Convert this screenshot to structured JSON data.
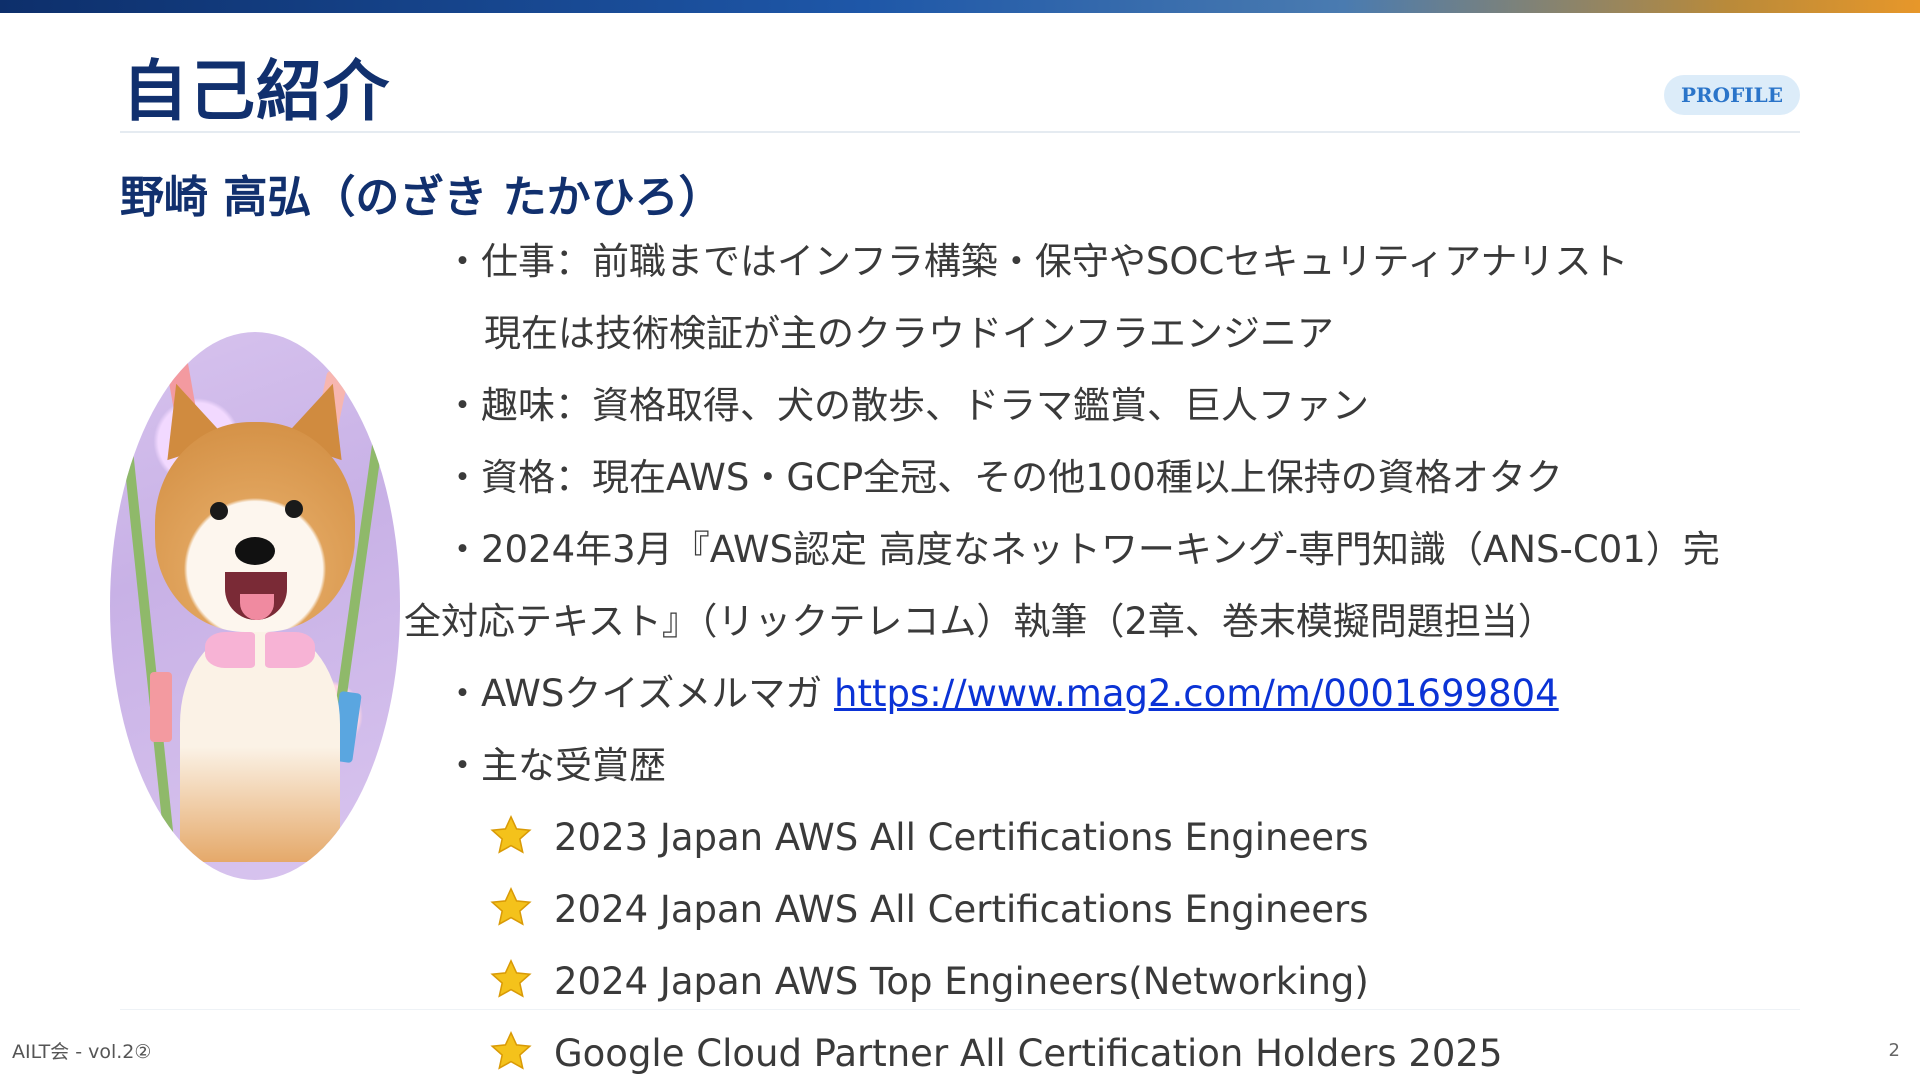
{
  "header": {
    "title": "自己紹介",
    "badge": "PROFILE"
  },
  "profile": {
    "name": "野崎 高弘（のざき たかひろ）",
    "lines": [
      "・仕事：前職まではインフラ構築・保守やSOCセキュリティアナリスト",
      "現在は技術検証が主のクラウドインフラエンジニア",
      "・趣味：資格取得、犬の散歩、ドラマ鑑賞、巨人ファン",
      "・資格：現在AWS・GCP全冠、その他100種以上保持の資格オタク",
      "・2024年3月『AWS認定 高度なネットワーキング-専門知識（ANS-C01）完",
      "全対応テキスト』（リックテレコム）執筆（2章、巻末模擬問題担当）"
    ],
    "newsletter": {
      "prefix": "・AWSクイズメルマガ ",
      "url": "https://www.mag2.com/m/0001699804"
    },
    "awards_heading": "・主な受賞歴",
    "awards": [
      "2023 Japan AWS All Certifications Engineers",
      "2024 Japan AWS All Certifications Engineers",
      "2024 Japan AWS Top Engineers(Networking)",
      "Google Cloud Partner All Certification Holders 2025"
    ],
    "award_icon": "star-icon"
  },
  "footer": {
    "event": "AILT会 - vol.2②",
    "page": "2"
  },
  "colors": {
    "title": "#11306e",
    "badge_bg": "#dcecf9",
    "badge_text": "#2a74c9",
    "link": "#0b33d6",
    "star": "#f4c21b"
  }
}
